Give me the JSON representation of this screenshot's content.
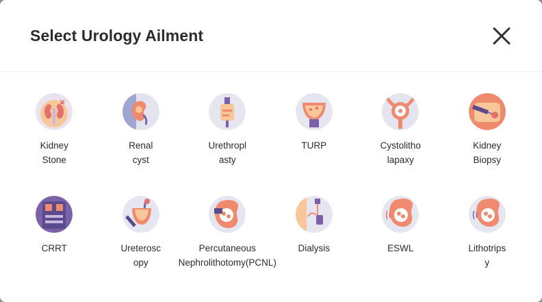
{
  "modal": {
    "title": "Select Urology Ailment",
    "close_label": "Close"
  },
  "ailments": [
    {
      "label": "Kidney Stone",
      "icon": "kidney-stone-icon"
    },
    {
      "label": "Renal cyst",
      "icon": "renal-cyst-icon"
    },
    {
      "label": "Urethroplasty",
      "icon": "urethroplasty-icon"
    },
    {
      "label": "TURP",
      "icon": "turp-icon"
    },
    {
      "label": "Cystolitholapaxy",
      "icon": "cystolitholapaxy-icon"
    },
    {
      "label": "Kidney Biopsy",
      "icon": "kidney-biopsy-icon"
    },
    {
      "label": "CRRT",
      "icon": "crrt-icon"
    },
    {
      "label": "Ureteroscopy",
      "icon": "ureteroscopy-icon"
    },
    {
      "label": "Percutaneous Nephrolithotomy(PCNL)",
      "icon": "pcnl-icon"
    },
    {
      "label": "Dialysis",
      "icon": "dialysis-icon"
    },
    {
      "label": "ESWL",
      "icon": "eswl-icon"
    },
    {
      "label": "Lithotripsy",
      "icon": "lithotripsy-icon"
    }
  ],
  "colors": {
    "icon_bg": "#e6e6f0",
    "icon_accent": "#f08a6e",
    "icon_purple": "#7b62a8",
    "icon_peach": "#f7c79a"
  }
}
